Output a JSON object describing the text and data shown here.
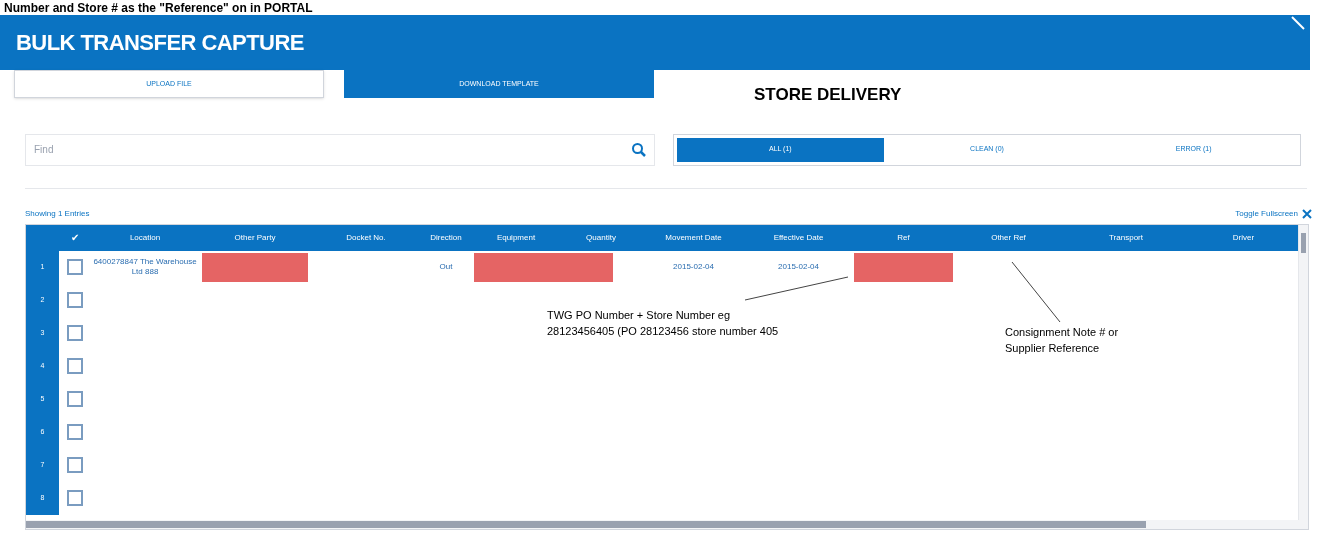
{
  "caption": "Number and Store # as the \"Reference\" on in PORTAL",
  "header": {
    "title": "BULK TRANSFER CAPTURE"
  },
  "actions": [
    {
      "label": "UPLOAD FILE",
      "selected": false
    },
    {
      "label": "DOWNLOAD TEMPLATE",
      "selected": true
    }
  ],
  "section_title": "STORE DELIVERY",
  "search": {
    "placeholder": "Find"
  },
  "filters": [
    {
      "label": "ALL (1)",
      "selected": true
    },
    {
      "label": "CLEAN (0)",
      "selected": false
    },
    {
      "label": "ERROR (1)",
      "selected": false
    }
  ],
  "entries_count": "Showing 1 Entries",
  "toggle_fullscreen": "Toggle Fullscreen",
  "table": {
    "check_header": "✔",
    "columns": [
      "Location",
      "Other Party",
      "Docket No.",
      "Direction",
      "Equipment",
      "Quantity",
      "Movement Date",
      "Effective Date",
      "Ref",
      "Other Ref",
      "Transport",
      "Driver"
    ],
    "rows": [
      {
        "number": "1",
        "checked": false,
        "cells": [
          {
            "kind": "text",
            "text": "6400278847 The Warehouse Ltd 888"
          },
          {
            "kind": "redacted"
          },
          {
            "kind": "text",
            "text": ""
          },
          {
            "kind": "text",
            "text": "Out"
          },
          {
            "kind": "redacted"
          },
          {
            "kind": "redacted"
          },
          {
            "kind": "text",
            "text": "2015-02-04"
          },
          {
            "kind": "text",
            "text": "2015-02-04"
          },
          {
            "kind": "redacted"
          },
          {
            "kind": "text",
            "text": ""
          },
          {
            "kind": "text",
            "text": ""
          },
          {
            "kind": "text",
            "text": ""
          }
        ]
      },
      {
        "number": "2",
        "checked": false,
        "cells": []
      },
      {
        "number": "3",
        "checked": false,
        "cells": []
      },
      {
        "number": "4",
        "checked": false,
        "cells": []
      },
      {
        "number": "5",
        "checked": false,
        "cells": []
      },
      {
        "number": "6",
        "checked": false,
        "cells": []
      },
      {
        "number": "7",
        "checked": false,
        "cells": []
      },
      {
        "number": "8",
        "checked": false,
        "cells": []
      }
    ]
  },
  "annotations": [
    {
      "text": "TWG PO Number + Store Number eg 28123456405 (PO 28123456 store number 405"
    },
    {
      "text": "Consignment Note # or Supplier Reference"
    }
  ]
}
